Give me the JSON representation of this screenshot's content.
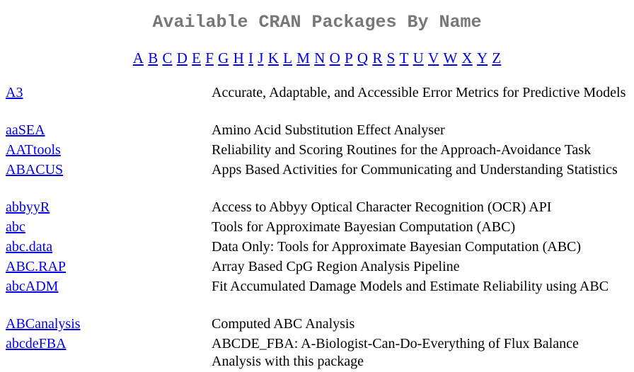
{
  "page": {
    "title": "Available CRAN Packages By Name",
    "title_color": "#777777",
    "link_color": "#0000ee"
  },
  "letters": [
    "A",
    "B",
    "C",
    "D",
    "E",
    "F",
    "G",
    "H",
    "I",
    "J",
    "K",
    "L",
    "M",
    "N",
    "O",
    "P",
    "Q",
    "R",
    "S",
    "T",
    "U",
    "V",
    "W",
    "X",
    "Y",
    "Z"
  ],
  "packages": [
    {
      "name": "A3",
      "description": "Accurate, Adaptable, and Accessible Error Metrics for Predictive Models"
    },
    {
      "name": "aaSEA",
      "description": "Amino Acid Substitution Effect Analyser"
    },
    {
      "name": "AATtools",
      "description": "Reliability and Scoring Routines for the Approach-Avoidance Task"
    },
    {
      "name": "ABACUS",
      "description": "Apps Based Activities for Communicating and Understanding Statistics"
    },
    {
      "name": "abbyyR",
      "description": "Access to Abbyy Optical Character Recognition (OCR) API"
    },
    {
      "name": "abc",
      "description": "Tools for Approximate Bayesian Computation (ABC)"
    },
    {
      "name": "abc.data",
      "description": "Data Only: Tools for Approximate Bayesian Computation (ABC)"
    },
    {
      "name": "ABC.RAP",
      "description": "Array Based CpG Region Analysis Pipeline"
    },
    {
      "name": "abcADM",
      "description": "Fit Accumulated Damage Models and Estimate Reliability using ABC"
    },
    {
      "name": "ABCanalysis",
      "description": "Computed ABC Analysis"
    },
    {
      "name": "abcdeFBA",
      "description": "ABCDE_FBA: A-Biologist-Can-Do-Everything of Flux Balance Analysis with this package"
    }
  ]
}
